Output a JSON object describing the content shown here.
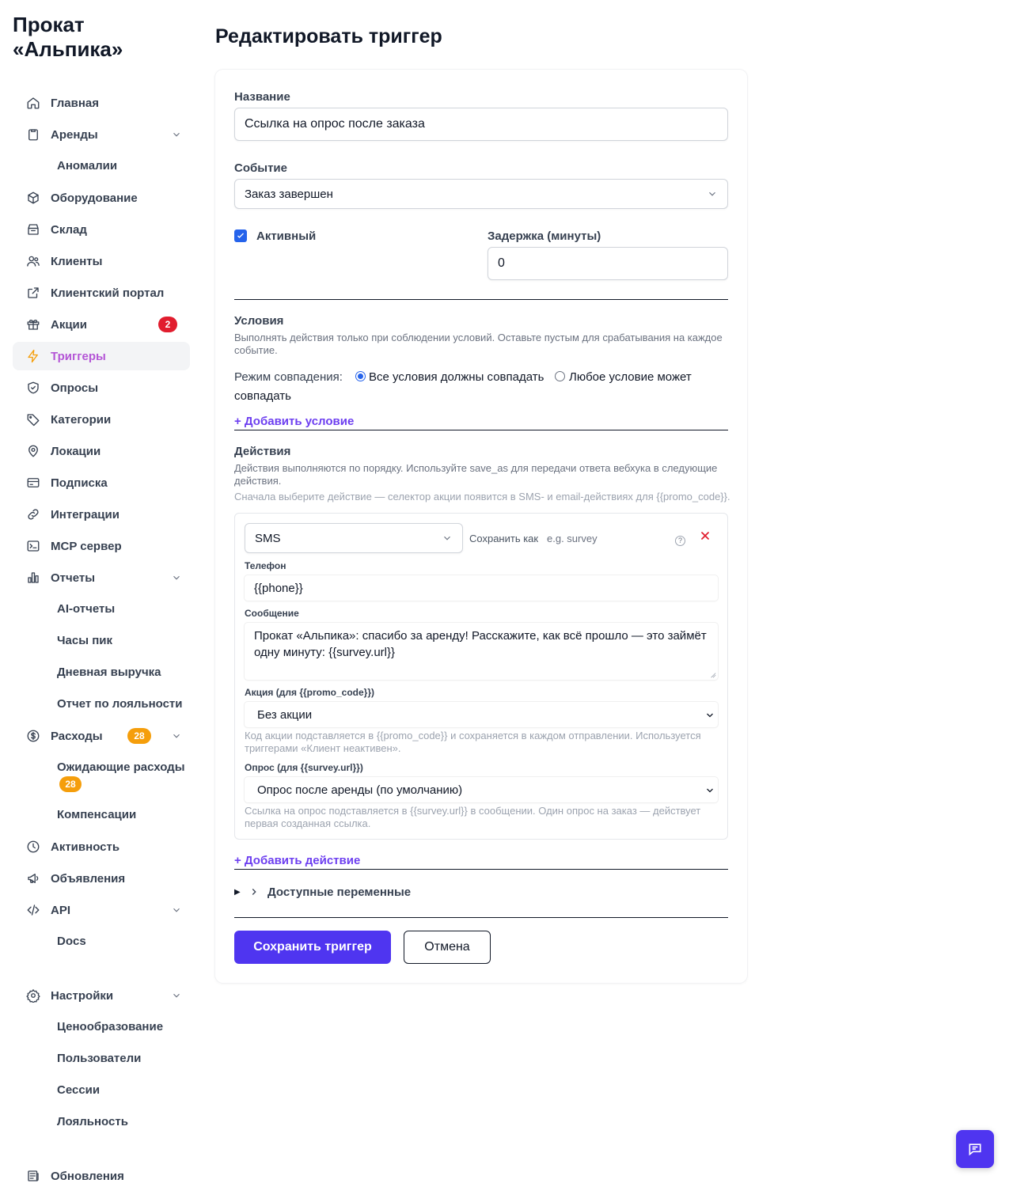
{
  "brand": {
    "line1": "Прокат",
    "line2": "«Альпика»"
  },
  "sidebar": {
    "items": [
      {
        "label": "Главная",
        "icon": "home-icon"
      },
      {
        "label": "Аренды",
        "icon": "clipboard-icon"
      },
      {
        "label": "Оборудование",
        "icon": "box-icon"
      },
      {
        "label": "Склад",
        "icon": "archive-icon"
      },
      {
        "label": "Клиенты",
        "icon": "users-icon"
      },
      {
        "label": "Клиентский портал",
        "icon": "external-link-icon"
      },
      {
        "label": "Акции",
        "icon": "gift-icon",
        "badge": "2"
      },
      {
        "label": "Триггеры",
        "icon": "zap-icon"
      },
      {
        "label": "Опросы",
        "icon": "shield-icon"
      },
      {
        "label": "Категории",
        "icon": "tag-icon"
      },
      {
        "label": "Локации",
        "icon": "map-pin-icon"
      },
      {
        "label": "Подписка",
        "icon": "credit-card-icon"
      },
      {
        "label": "Интеграции",
        "icon": "link-icon"
      },
      {
        "label": "MCP сервер",
        "icon": "terminal-icon"
      },
      {
        "label": "Отчеты",
        "icon": "bar-chart-icon"
      },
      {
        "label": "Расходы",
        "icon": "dollar-icon",
        "badge": "28"
      },
      {
        "label": "Активность",
        "icon": "clock-icon"
      },
      {
        "label": "Объявления",
        "icon": "megaphone-icon"
      },
      {
        "label": "API",
        "icon": "code-icon"
      },
      {
        "label": "Настройки",
        "icon": "settings-icon"
      },
      {
        "label": "Обновления",
        "icon": "newspaper-icon"
      }
    ],
    "sub": {
      "anomalies": "Аномалии",
      "ai_reports": "AI-отчеты",
      "peak_hours": "Часы пик",
      "daily_revenue": "Дневная выручка",
      "loyalty_report": "Отчет по лояльности",
      "pending_expenses": "Ожидающие расходы",
      "pending_badge": "28",
      "compensations": "Компенсации",
      "docs": "Docs",
      "pricing": "Ценообразование",
      "users": "Пользователи",
      "sessions": "Сессии",
      "loyalty": "Лояльность"
    }
  },
  "page": {
    "title": "Редактировать триггер"
  },
  "form": {
    "name_label": "Название",
    "name_value": "Ссылка на опрос после заказа",
    "event_label": "Событие",
    "event_value": "Заказ завершен",
    "active_label": "Активный",
    "delay_label": "Задержка (минуты)",
    "delay_value": "0",
    "conditions_title": "Условия",
    "conditions_desc_1": "Выполнять действия только при соблюдении условий. Оставьте пустым для срабатывания на каждое",
    "conditions_desc_2": "событие.",
    "match_mode_label": "Режим совпадения:",
    "match_all": "Все условия должны совпадать",
    "match_any_1": "Любое условие может",
    "match_any_2": "совпадать",
    "add_condition": "+ Добавить условие",
    "actions_title": "Действия",
    "actions_desc_1": "Действия выполняются по порядку. Используйте save_as для передачи ответа вебхука в следующие",
    "actions_desc_2": "действия.",
    "actions_hint": "Сначала выберите действие — селектор акции появится в SMS- и email-действиях для {{promo_code}}.",
    "action": {
      "type": "SMS",
      "save_as_label": "Сохранить как",
      "save_as_placeholder": "e.g. survey",
      "help": "?",
      "phone_label": "Телефон",
      "phone_value": "{{phone}}",
      "message_label": "Сообщение",
      "message_line1": "Прокат «Альпика»: спасибо за аренду! Расскажите, как всё прошло — это займёт",
      "message_line2": "одну минуту: {{survey.url}}",
      "promo_label": "Акция (для {{promo_code}})",
      "promo_value": "Без акции",
      "promo_hint_1": "Код акции подставляется в {{promo_code}} и сохраняется в каждом отправлении. Используется",
      "promo_hint_2": "триггерами «Клиент неактивен».",
      "survey_label": "Опрос (для {{survey.url}})",
      "survey_value": "Опрос после аренды (по умолчанию)",
      "survey_hint_1": "Ссылка на опрос подставляется в {{survey.url}} в сообщении. Один опрос на заказ — действует",
      "survey_hint_2": "первая созданная ссылка."
    },
    "add_action": "+ Добавить действие",
    "variables_label": "Доступные переменные",
    "save_button": "Сохранить триггер",
    "cancel_button": "Отмена"
  },
  "colors": {
    "accent": "#4f35f0",
    "active_nav": "#b455d6",
    "badge_red": "#e11d2e",
    "badge_orange": "#f59e0b",
    "checkbox": "#2563eb"
  }
}
